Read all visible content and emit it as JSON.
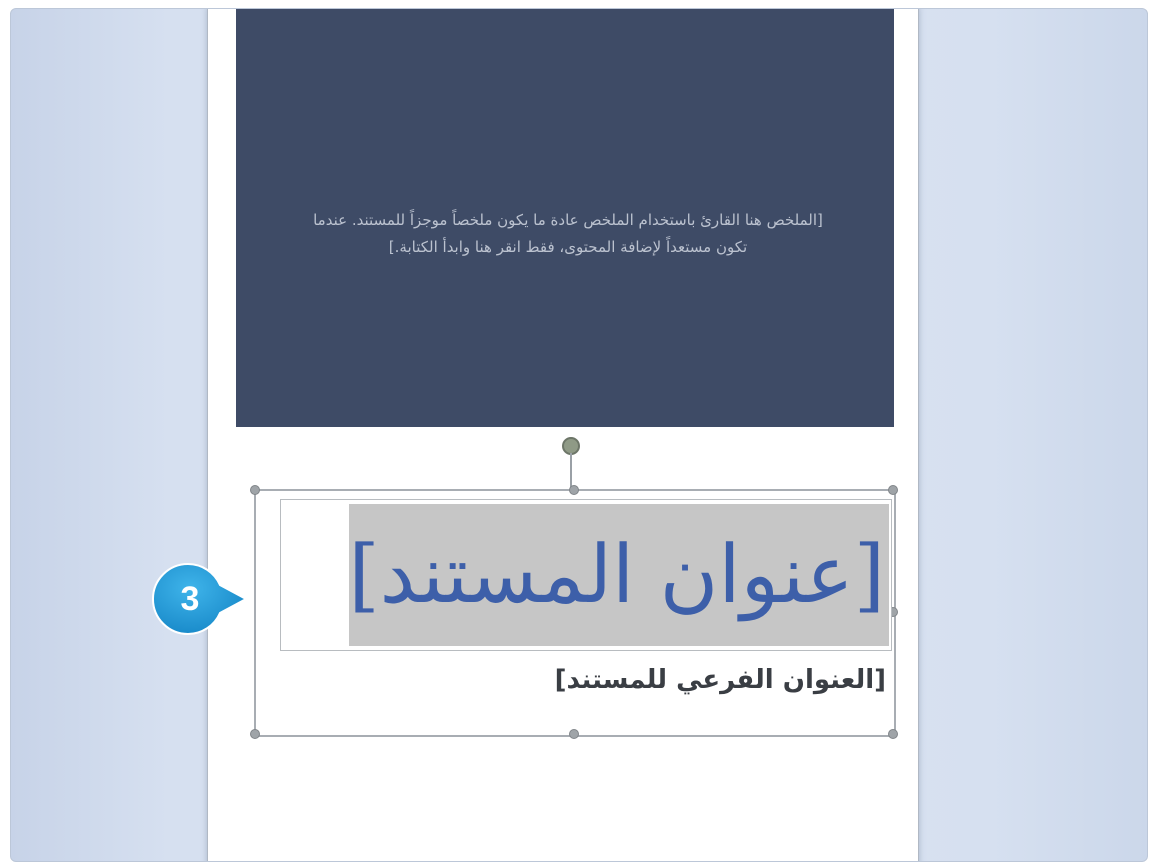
{
  "document": {
    "abstract": "[الملخص هنا القارئ باستخدام الملخص عادة ما يكون ملخصاً موجزاً للمستند. عندما تكون مستعداً لإضافة المحتوى، فقط انقر هنا وابدأ الكتابة.]",
    "title": "[عنوان المستند]",
    "subtitle": "[العنوان الفرعي للمستند]"
  },
  "callout": {
    "step": "3",
    "color": "#1f9ad6"
  },
  "colors": {
    "cover": "#3e4b66",
    "title": "#3d5fa9",
    "selection": "#c6c6c6"
  }
}
